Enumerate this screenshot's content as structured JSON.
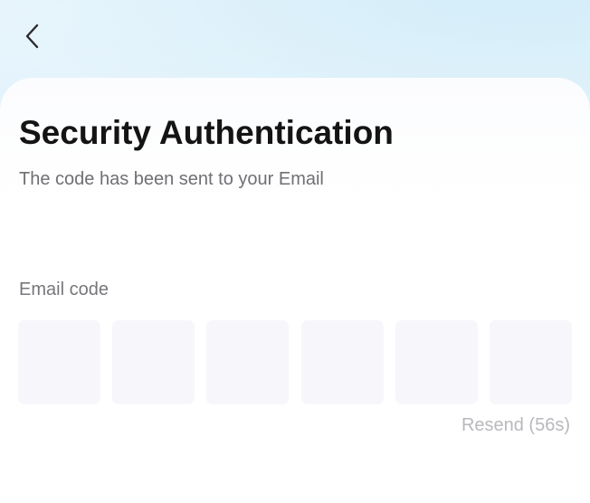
{
  "header": {
    "back_icon": "chevron-left-icon"
  },
  "main": {
    "title": "Security Authentication",
    "subtitle": "The code has been sent to your Email",
    "email_code_label": "Email code",
    "code_boxes": [
      "",
      "",
      "",
      "",
      "",
      ""
    ],
    "resend_label": "Resend (56s)"
  },
  "colors": {
    "title": "#141414",
    "subtitle": "#6f6f74",
    "code_box_bg": "#f7f7fb",
    "resend_disabled": "#b8b8bd"
  }
}
